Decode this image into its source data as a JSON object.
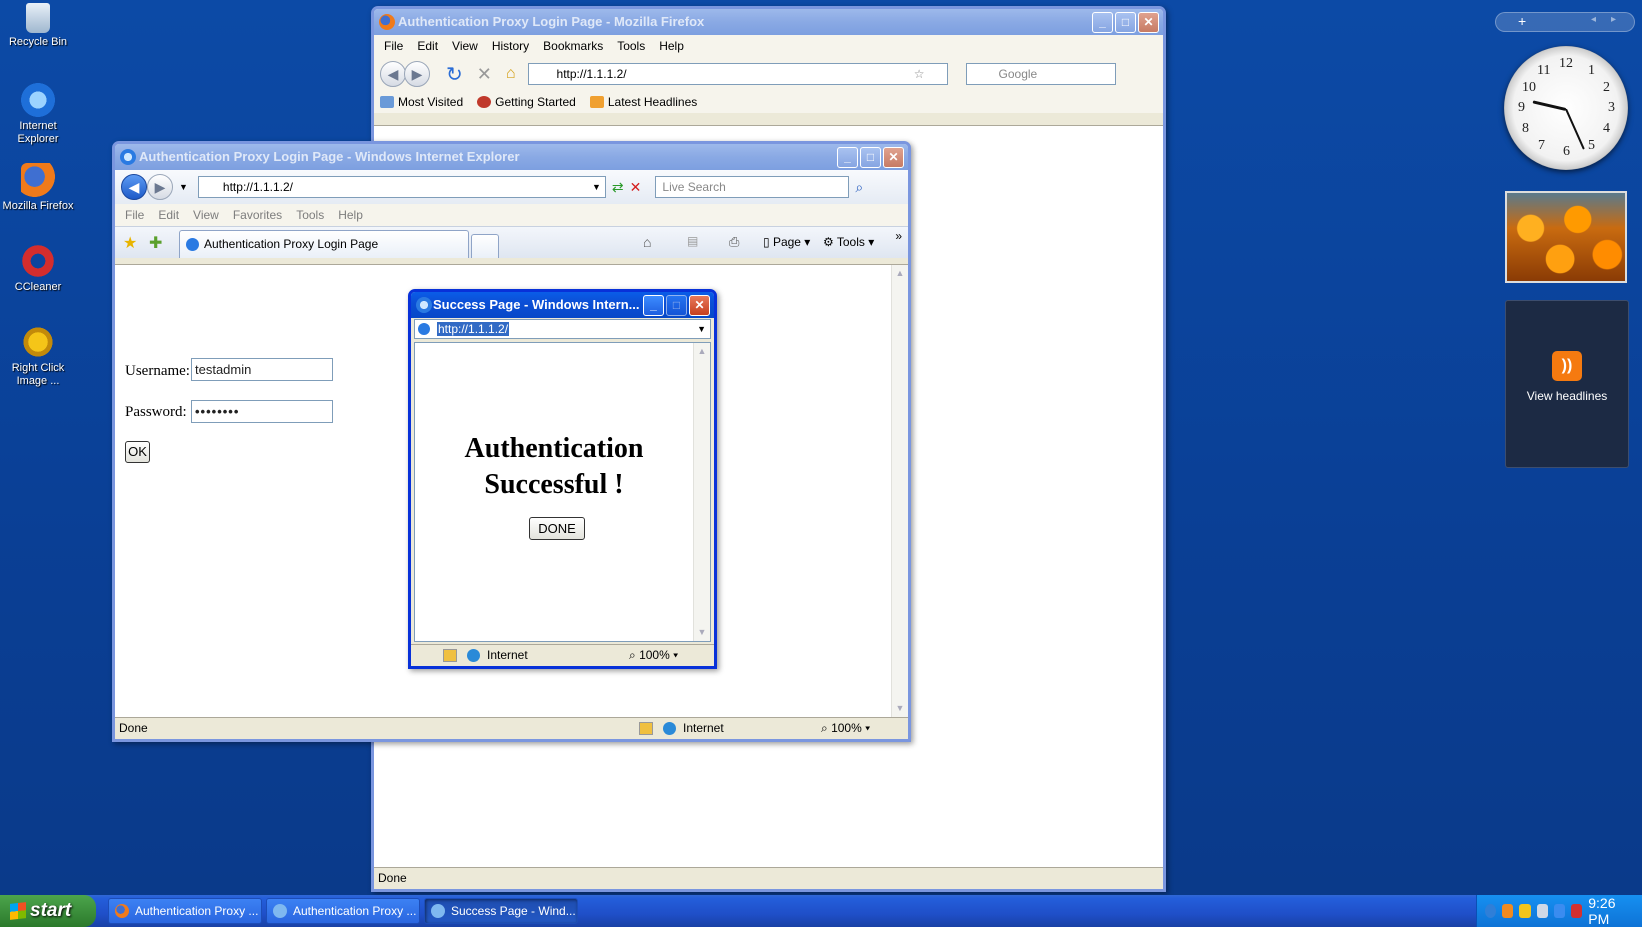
{
  "desktop": {
    "icons": [
      {
        "label": "Recycle Bin"
      },
      {
        "label": "Internet Explorer"
      },
      {
        "label": "Mozilla Firefox"
      },
      {
        "label": "CCleaner"
      },
      {
        "label": "Right Click Image ..."
      }
    ]
  },
  "gadgets": {
    "feed_label": "View headlines",
    "clock_numbers": [
      "12",
      "1",
      "2",
      "3",
      "4",
      "5",
      "6",
      "7",
      "8",
      "9",
      "10",
      "11"
    ]
  },
  "firefox": {
    "title": "Authentication Proxy Login Page - Mozilla Firefox",
    "menu": [
      "File",
      "Edit",
      "View",
      "History",
      "Bookmarks",
      "Tools",
      "Help"
    ],
    "url": "http://1.1.1.2/",
    "search_placeholder": "Google",
    "bookmarks": [
      "Most Visited",
      "Getting Started",
      "Latest Headlines"
    ],
    "status": "Done"
  },
  "ie": {
    "title": "Authentication Proxy Login Page - Windows Internet Explorer",
    "url": "http://1.1.1.2/",
    "search_placeholder": "Live Search",
    "menu": [
      "File",
      "Edit",
      "View",
      "Favorites",
      "Tools",
      "Help"
    ],
    "tab_label": "Authentication Proxy Login Page",
    "cmd_page": "Page",
    "cmd_tools": "Tools",
    "form": {
      "username_label": "Username:",
      "username_value": "testadmin",
      "password_label": "Password:",
      "password_value": "••••••••",
      "ok_label": "OK"
    },
    "status": "Done",
    "zone": "Internet",
    "zoom": "100%"
  },
  "popup": {
    "title": "Success Page - Windows Intern...",
    "url": "http://1.1.1.2/",
    "heading_line1": "Authentication",
    "heading_line2": "Successful !",
    "done_label": "DONE",
    "zone": "Internet",
    "zoom": "100%"
  },
  "taskbar": {
    "start_label": "start",
    "items": [
      {
        "label": "Authentication Proxy ..."
      },
      {
        "label": "Authentication Proxy ..."
      },
      {
        "label": "Success Page - Wind..."
      }
    ],
    "time": "9:26 PM"
  },
  "colors": {
    "desktop_bg": "#0a3f95",
    "titlebar_active": "#0b4fd6",
    "taskbar": "#245edb",
    "start_green": "#3c8f3c"
  }
}
